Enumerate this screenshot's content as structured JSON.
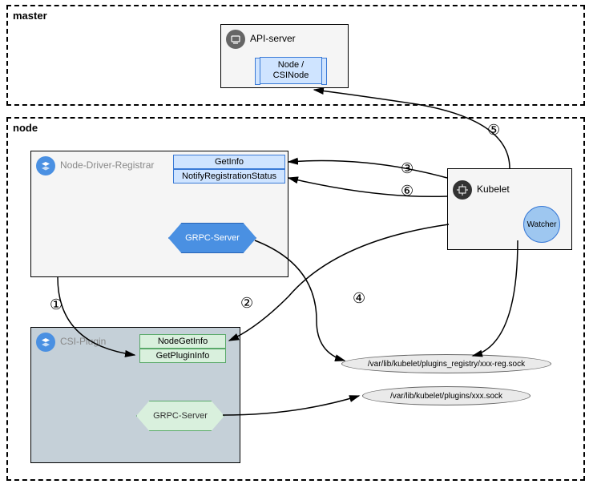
{
  "master": {
    "label": "master",
    "api_server": {
      "label": "API-server",
      "resource": "Node / CSINode"
    }
  },
  "node": {
    "label": "node",
    "registrar": {
      "label": "Node-Driver-Registrar",
      "get_info": "GetInfo",
      "notify": "NotifyRegistrationStatus",
      "grpc": "GRPC-Server"
    },
    "csi": {
      "label": "CSI-Plugin",
      "node_get_info": "NodeGetInfo",
      "get_plugin_info": "GetPluginInfo",
      "grpc": "GRPC-Server"
    },
    "kubelet": {
      "label": "Kubelet",
      "watcher": "Watcher"
    },
    "sockets": {
      "reg": "/var/lib/kubelet/plugins_registry/xxx-reg.sock",
      "plugin": "/var/lib/kubelet/plugins/xxx.sock"
    }
  },
  "steps": {
    "s1": "①",
    "s2": "②",
    "s3": "③",
    "s4": "④",
    "s5": "⑤",
    "s6": "⑥"
  }
}
